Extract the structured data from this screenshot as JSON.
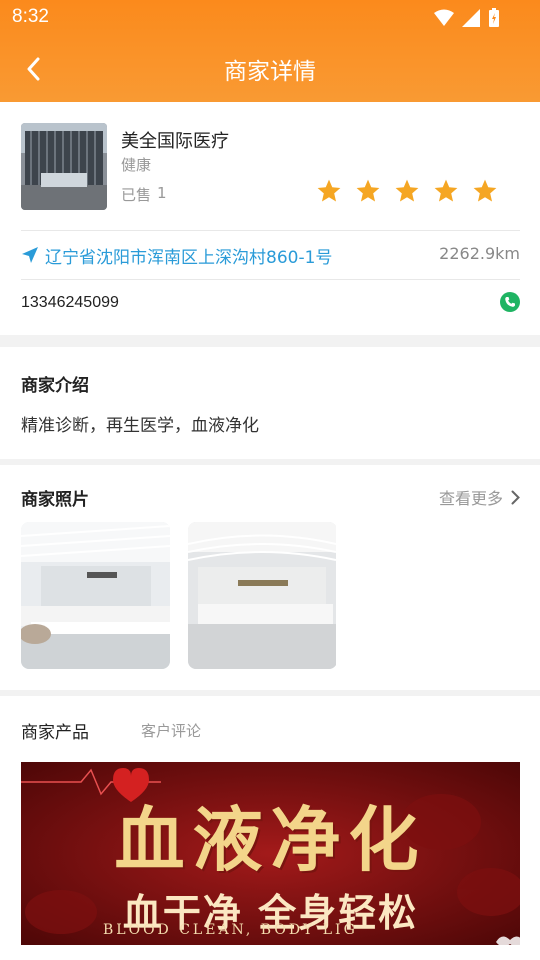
{
  "status_bar": {
    "time": "8:32"
  },
  "header": {
    "title": "商家详情"
  },
  "merchant": {
    "name": "美全国际医疗",
    "category": "健康",
    "sold_label": "已售",
    "sold_count": "1",
    "rating_stars": 5,
    "address": "辽宁省沈阳市浑南区上深沟村860-1号",
    "distance": "2262.9km",
    "phone": "13346245099"
  },
  "intro": {
    "title": "商家介绍",
    "text": "精准诊断，再生医学，血液净化"
  },
  "photos": {
    "title": "商家照片",
    "more": "查看更多"
  },
  "products": {
    "tabs": [
      "商家产品",
      "客户评论"
    ],
    "banner": {
      "title": "血液净化",
      "subtitle": "血干净 全身轻松",
      "english": "BLOOD CLEAN, BODY LIG"
    }
  },
  "colors": {
    "header": "#fb8a1c",
    "star": "#f5a623",
    "link": "#2a9bd8",
    "phone": "#1fb463"
  }
}
